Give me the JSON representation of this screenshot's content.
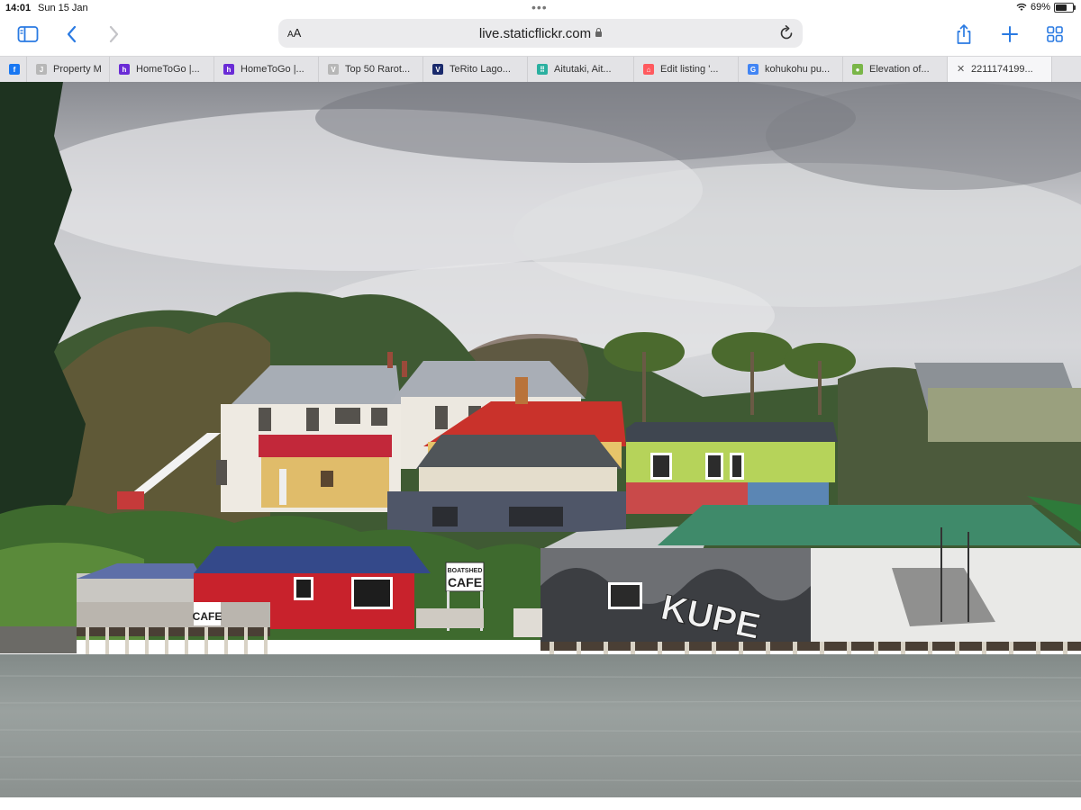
{
  "status": {
    "time": "14:01",
    "date": "Sun 15 Jan",
    "battery": "69%",
    "battery_level": 0.69
  },
  "toolbar": {
    "reader_label": "AA",
    "url": "live.staticflickr.com"
  },
  "tabs": [
    {
      "title": "",
      "icon": "facebook-icon",
      "color": "#1877f2"
    },
    {
      "title": "Property M",
      "icon": "j-icon",
      "color": "#b7b7b7"
    },
    {
      "title": "HomeToGo |...",
      "icon": "hometogo-icon",
      "color": "#6a2bd6"
    },
    {
      "title": "HomeToGo |...",
      "icon": "hometogo-icon",
      "color": "#6a2bd6"
    },
    {
      "title": "Top 50 Rarot...",
      "icon": "v-icon",
      "color": "#b7b7b7"
    },
    {
      "title": "TeRito Lago...",
      "icon": "terito-icon",
      "color": "#1a2a6c"
    },
    {
      "title": "Aitutaki, Ait...",
      "icon": "dots-icon",
      "color": "#2bb0a0"
    },
    {
      "title": "Edit listing '...",
      "icon": "airbnb-icon",
      "color": "#ff5a5f"
    },
    {
      "title": "kohukohu pu...",
      "icon": "google-icon",
      "color": "#4285f4"
    },
    {
      "title": "Elevation of...",
      "icon": "globe-icon",
      "color": "#7ab648"
    },
    {
      "title": "2211174199...",
      "icon": "close-icon",
      "color": "#555555",
      "active": true
    }
  ],
  "photo": {
    "signs": {
      "cafe_small": "CAFE",
      "boatshed_top": "BOATSHED",
      "boatshed_cafe": "CAFE",
      "mural": "KUPE"
    }
  }
}
